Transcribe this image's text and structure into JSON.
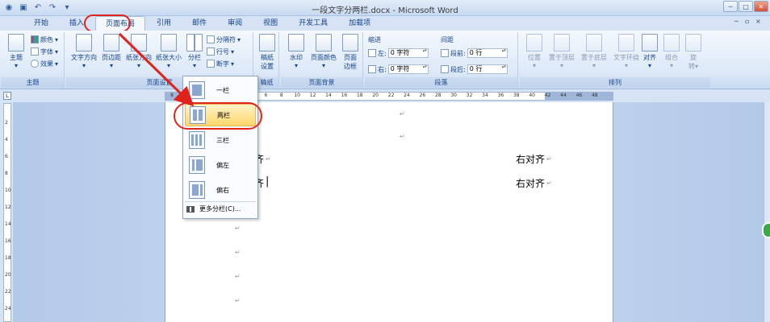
{
  "window": {
    "title": "一段文字分两栏.docx - Microsoft Word"
  },
  "tabs": [
    "开始",
    "插入",
    "页面布局",
    "引用",
    "邮件",
    "审阅",
    "视图",
    "开发工具",
    "加载项"
  ],
  "ribbon": {
    "theme": {
      "label": "主题",
      "big": "主题",
      "colors": "颜色",
      "fonts": "字体",
      "effects": "效果"
    },
    "page_setup": {
      "label": "页面设置",
      "text_direction": "文字方向",
      "margins": "页边距",
      "orientation": "纸张方向",
      "size": "纸张大小",
      "columns": "分栏",
      "breaks": "分隔符",
      "line_numbers": "行号",
      "hyphenation": "断字"
    },
    "manuscript": {
      "label": "稿纸",
      "big": "稿纸",
      "big2": "设置"
    },
    "page_background": {
      "label": "页面背景",
      "watermark": "水印",
      "page_color": "页面颜色",
      "page_border": "页面",
      "page_border2": "边框"
    },
    "paragraph": {
      "label": "段落",
      "indent": "缩进",
      "spacing": "间距",
      "left": "左:",
      "right": "右:",
      "before": "段前:",
      "after": "段后:",
      "left_val": "0 字符",
      "right_val": "0 字符",
      "before_val": "0 行",
      "after_val": "0 行"
    },
    "arrange": {
      "label": "排列",
      "position": "位置",
      "bring_front": "置于顶层",
      "send_back": "置于底层",
      "wrap_text": "文字环绕",
      "align": "对齐",
      "group": "组合",
      "rotate": "旋",
      "rotate2": "转"
    }
  },
  "ruler": {
    "ticks": [
      "8",
      "6",
      "4",
      "2",
      "2",
      "4",
      "6",
      "8",
      "10",
      "12",
      "14",
      "16",
      "18",
      "20",
      "22",
      "24",
      "26",
      "28",
      "30",
      "32",
      "34",
      "36",
      "38",
      "40",
      "42",
      "44",
      "46",
      "48"
    ]
  },
  "vruler": {
    "ticks": [
      "2",
      "4",
      "6",
      "8",
      "10",
      "12",
      "14",
      "16",
      "18",
      "20",
      "22",
      "24"
    ]
  },
  "dropdown": {
    "items": [
      "一栏",
      "两栏",
      "三栏",
      "偏左",
      "偏右"
    ],
    "selected": "两栏",
    "more": "更多分栏(C)..."
  },
  "document": {
    "left_frag1": "齐",
    "left_frag2": "齐",
    "right_line1": "右对齐",
    "right_line2": "右对齐",
    "para_mark": "↵"
  }
}
